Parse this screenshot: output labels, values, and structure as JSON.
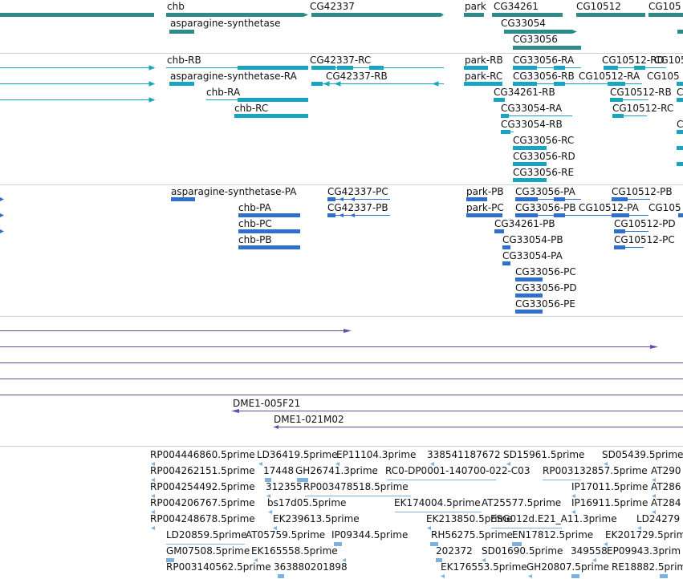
{
  "genes_track": {
    "labels": [
      "chb",
      "CG42337",
      "park",
      "CG34261",
      "CG10512",
      "CG105",
      "asparagine-synthetase",
      "CG33054",
      "CG33056"
    ],
    "color": "#2e8b8b"
  },
  "transcripts_track": {
    "labels": [
      "chb-RB",
      "CG42337-RC",
      "park-RB",
      "CG33056-RA",
      "CG10512-RD",
      "CG105",
      "asparagine-synthetase-RA",
      "CG42337-RB",
      "park-RC",
      "CG33056-RB",
      "CG10512-RA",
      "CG105",
      "chb-RA",
      "CG34261-RB",
      "CG10512-RB",
      "C",
      "chb-RC",
      "CG33054-RA",
      "CG10512-RC",
      "CG33054-RB",
      "C",
      "CG33056-RC",
      "CG33056-RD",
      "CG33056-RE"
    ],
    "color": "#17a5c0"
  },
  "proteins_track": {
    "labels": [
      "asparagine-synthetase-PA",
      "CG42337-PC",
      "park-PB",
      "CG33056-PA",
      "CG10512-PB",
      "chb-PA",
      "CG42337-PB",
      "park-PC",
      "CG33056-PB",
      "CG10512-PA",
      "CG105",
      "CG34261-PB",
      "CG10512-PD",
      "chb-PC",
      "CG33054-PB",
      "CG10512-PC",
      "chb-PB",
      "CG33054-PA",
      "CG33056-PC",
      "CG33056-PD",
      "CG33056-PE"
    ],
    "color": "#2f6fce"
  },
  "clones_track": {
    "labels": [
      "DME1-005F21",
      "DME1-021M02"
    ],
    "color": "#6a4aa8"
  },
  "est_track": {
    "labels": [
      "RP004446860.5prime",
      "LD36419.5prime",
      "EP11104.3prime",
      "338541187672",
      "SD15961.5prime",
      "SD05439.5prime",
      "RP004262151.5prime",
      "17448",
      "GH26741.3prime",
      "RC0-DP0001-140700-022-C03",
      "RP003132857.5prime",
      "AT290",
      "RP004254492.5prime",
      "312355",
      "RP003478518.5prime",
      "IP17011.5prime",
      "AT286",
      "RP004206767.5prime",
      "bs17d05.5prime",
      "EK174004.5prime",
      "AT25577.5prime",
      "IP16911.5prime",
      "AT284",
      "RP004248678.5prime",
      "EK239613.5prime",
      "EK213850.5prime",
      "ESG012d.E21_A11.3prime",
      "LD24279",
      "LD20859.5prime",
      "AT05759.5prime",
      "IP09344.5prime",
      "RH56275.5prime",
      "EN17812.5prime",
      "EK201729.5prim",
      "GM07508.5prime",
      "EK165558.5prime",
      "202372",
      "SD01690.5prime",
      "349558",
      "EP09943.3prim",
      "RP003140562.5prime",
      "363880201898",
      "EK176553.5prime",
      "GH20807.5prime",
      "RE18882.5prim"
    ],
    "color": "#7fb1de"
  }
}
